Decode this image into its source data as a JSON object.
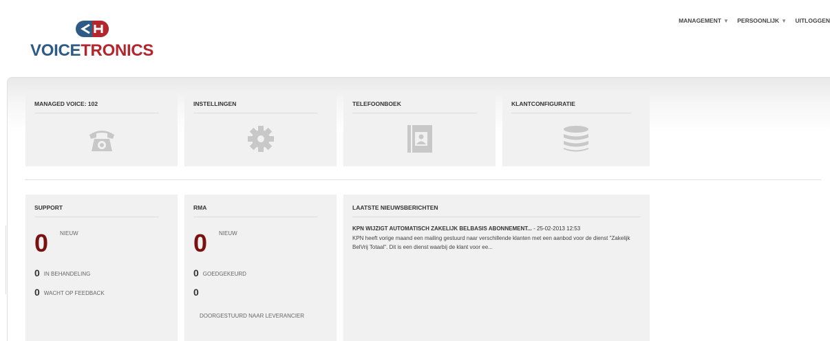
{
  "brand": {
    "part1": "VOICE",
    "part2": "TRONICS",
    "mark_text": "<H"
  },
  "colors": {
    "brand_blue": "#2e5a86",
    "brand_red": "#b3262d",
    "counter_red": "#7a1010",
    "tile_bg": "#f1f1f1"
  },
  "nav": [
    {
      "label": "MANAGEMENT",
      "dropdown": true
    },
    {
      "label": "PERSOONLIJK",
      "dropdown": true
    },
    {
      "label": "UITLOGGEN",
      "dropdown": false
    }
  ],
  "nav_caret": "▼",
  "tiles": {
    "managed_voice": {
      "title": "MANAGED VOICE: 102",
      "icon": "phone-icon"
    },
    "instellingen": {
      "title": "INSTELLINGEN",
      "icon": "gear-icon"
    },
    "telefoonboek": {
      "title": "TELEFOONBOEK",
      "icon": "contact-book-icon"
    },
    "klantconfiguratie": {
      "title": "KLANTCONFIGURATIE",
      "icon": "database-icon"
    }
  },
  "support": {
    "title": "SUPPORT",
    "new_count": "0",
    "new_label": "NIEUW",
    "in_behandeling_count": "0",
    "in_behandeling_label": "IN BEHANDELING",
    "wacht_count": "0",
    "wacht_label": "WACHT OP FEEDBACK"
  },
  "rma": {
    "title": "RMA",
    "new_count": "0",
    "new_label": "NIEUW",
    "goedgekeurd_count": "0",
    "goedgekeurd_label": "GOEDGEKEURD",
    "doorgestuurd_count": "0",
    "doorgestuurd_label": "DOORGESTUURD NAAR LEVERANCIER"
  },
  "news": {
    "title": "LAATSTE NIEUWSBERICHTEN",
    "item_headline": "KPN WIJZIGT AUTOMATISCH ZAKELIJK BELBASIS ABONNEMENT...",
    "item_meta": " - 25-02-2013 12:53",
    "item_body": "KPN heeft vorige maand een mailing gestuurd naar verschillende klanten met een aanbod voor de dienst \"Zakelijk BelVrij Totaal\". Dit is een dienst waarbij de klant voor ee..."
  }
}
